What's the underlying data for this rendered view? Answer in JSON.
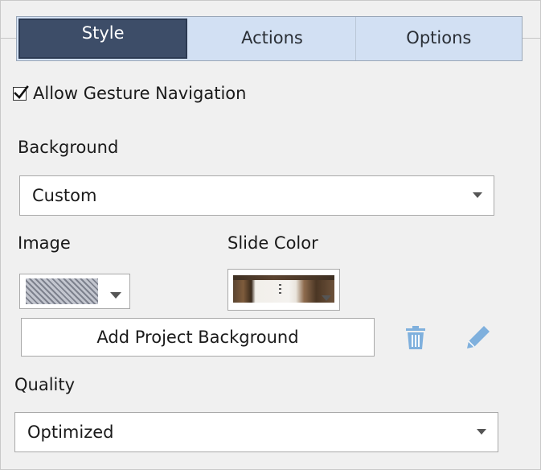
{
  "tabs": [
    {
      "label": "Style",
      "active": true
    },
    {
      "label": "Actions",
      "active": false
    },
    {
      "label": "Options",
      "active": false
    }
  ],
  "gesture": {
    "label": "Allow Gesture Navigation",
    "checked": true
  },
  "background": {
    "label": "Background",
    "value": "Custom"
  },
  "image": {
    "label": "Image",
    "swatch": "hatched-pattern"
  },
  "slide_color": {
    "label": "Slide Color",
    "swatch": "image-preview"
  },
  "add_background_button": "Add Project Background",
  "icons": {
    "delete": "trash-icon",
    "edit": "pencil-icon"
  },
  "quality": {
    "label": "Quality",
    "value": "Optimized"
  },
  "colors": {
    "tab_active_bg": "#3d4d68",
    "tab_inactive_bg": "#d2e0f3",
    "icon_blue": "#7fb0dd",
    "panel_bg": "#f0f0f0"
  }
}
